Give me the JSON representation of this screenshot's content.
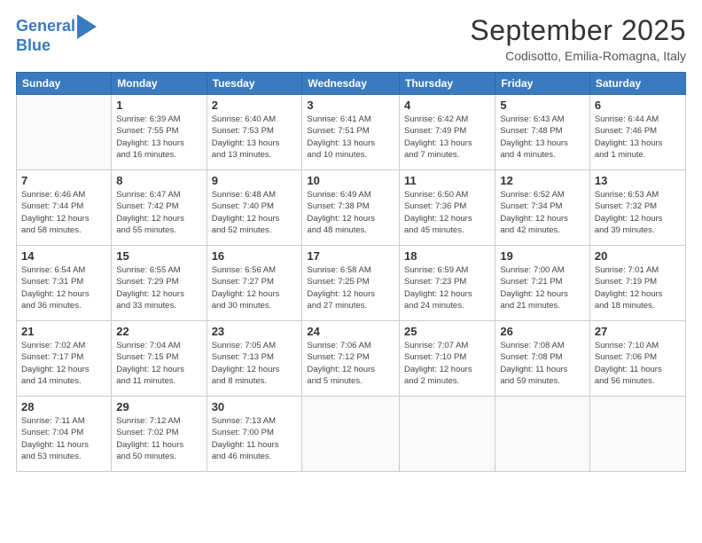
{
  "logo": {
    "line1": "General",
    "line2": "Blue"
  },
  "title": "September 2025",
  "location": "Codisotto, Emilia-Romagna, Italy",
  "weekdays": [
    "Sunday",
    "Monday",
    "Tuesday",
    "Wednesday",
    "Thursday",
    "Friday",
    "Saturday"
  ],
  "weeks": [
    [
      {
        "day": "",
        "info": ""
      },
      {
        "day": "1",
        "info": "Sunrise: 6:39 AM\nSunset: 7:55 PM\nDaylight: 13 hours\nand 16 minutes."
      },
      {
        "day": "2",
        "info": "Sunrise: 6:40 AM\nSunset: 7:53 PM\nDaylight: 13 hours\nand 13 minutes."
      },
      {
        "day": "3",
        "info": "Sunrise: 6:41 AM\nSunset: 7:51 PM\nDaylight: 13 hours\nand 10 minutes."
      },
      {
        "day": "4",
        "info": "Sunrise: 6:42 AM\nSunset: 7:49 PM\nDaylight: 13 hours\nand 7 minutes."
      },
      {
        "day": "5",
        "info": "Sunrise: 6:43 AM\nSunset: 7:48 PM\nDaylight: 13 hours\nand 4 minutes."
      },
      {
        "day": "6",
        "info": "Sunrise: 6:44 AM\nSunset: 7:46 PM\nDaylight: 13 hours\nand 1 minute."
      }
    ],
    [
      {
        "day": "7",
        "info": "Sunrise: 6:46 AM\nSunset: 7:44 PM\nDaylight: 12 hours\nand 58 minutes."
      },
      {
        "day": "8",
        "info": "Sunrise: 6:47 AM\nSunset: 7:42 PM\nDaylight: 12 hours\nand 55 minutes."
      },
      {
        "day": "9",
        "info": "Sunrise: 6:48 AM\nSunset: 7:40 PM\nDaylight: 12 hours\nand 52 minutes."
      },
      {
        "day": "10",
        "info": "Sunrise: 6:49 AM\nSunset: 7:38 PM\nDaylight: 12 hours\nand 48 minutes."
      },
      {
        "day": "11",
        "info": "Sunrise: 6:50 AM\nSunset: 7:36 PM\nDaylight: 12 hours\nand 45 minutes."
      },
      {
        "day": "12",
        "info": "Sunrise: 6:52 AM\nSunset: 7:34 PM\nDaylight: 12 hours\nand 42 minutes."
      },
      {
        "day": "13",
        "info": "Sunrise: 6:53 AM\nSunset: 7:32 PM\nDaylight: 12 hours\nand 39 minutes."
      }
    ],
    [
      {
        "day": "14",
        "info": "Sunrise: 6:54 AM\nSunset: 7:31 PM\nDaylight: 12 hours\nand 36 minutes."
      },
      {
        "day": "15",
        "info": "Sunrise: 6:55 AM\nSunset: 7:29 PM\nDaylight: 12 hours\nand 33 minutes."
      },
      {
        "day": "16",
        "info": "Sunrise: 6:56 AM\nSunset: 7:27 PM\nDaylight: 12 hours\nand 30 minutes."
      },
      {
        "day": "17",
        "info": "Sunrise: 6:58 AM\nSunset: 7:25 PM\nDaylight: 12 hours\nand 27 minutes."
      },
      {
        "day": "18",
        "info": "Sunrise: 6:59 AM\nSunset: 7:23 PM\nDaylight: 12 hours\nand 24 minutes."
      },
      {
        "day": "19",
        "info": "Sunrise: 7:00 AM\nSunset: 7:21 PM\nDaylight: 12 hours\nand 21 minutes."
      },
      {
        "day": "20",
        "info": "Sunrise: 7:01 AM\nSunset: 7:19 PM\nDaylight: 12 hours\nand 18 minutes."
      }
    ],
    [
      {
        "day": "21",
        "info": "Sunrise: 7:02 AM\nSunset: 7:17 PM\nDaylight: 12 hours\nand 14 minutes."
      },
      {
        "day": "22",
        "info": "Sunrise: 7:04 AM\nSunset: 7:15 PM\nDaylight: 12 hours\nand 11 minutes."
      },
      {
        "day": "23",
        "info": "Sunrise: 7:05 AM\nSunset: 7:13 PM\nDaylight: 12 hours\nand 8 minutes."
      },
      {
        "day": "24",
        "info": "Sunrise: 7:06 AM\nSunset: 7:12 PM\nDaylight: 12 hours\nand 5 minutes."
      },
      {
        "day": "25",
        "info": "Sunrise: 7:07 AM\nSunset: 7:10 PM\nDaylight: 12 hours\nand 2 minutes."
      },
      {
        "day": "26",
        "info": "Sunrise: 7:08 AM\nSunset: 7:08 PM\nDaylight: 11 hours\nand 59 minutes."
      },
      {
        "day": "27",
        "info": "Sunrise: 7:10 AM\nSunset: 7:06 PM\nDaylight: 11 hours\nand 56 minutes."
      }
    ],
    [
      {
        "day": "28",
        "info": "Sunrise: 7:11 AM\nSunset: 7:04 PM\nDaylight: 11 hours\nand 53 minutes."
      },
      {
        "day": "29",
        "info": "Sunrise: 7:12 AM\nSunset: 7:02 PM\nDaylight: 11 hours\nand 50 minutes."
      },
      {
        "day": "30",
        "info": "Sunrise: 7:13 AM\nSunset: 7:00 PM\nDaylight: 11 hours\nand 46 minutes."
      },
      {
        "day": "",
        "info": ""
      },
      {
        "day": "",
        "info": ""
      },
      {
        "day": "",
        "info": ""
      },
      {
        "day": "",
        "info": ""
      }
    ]
  ]
}
